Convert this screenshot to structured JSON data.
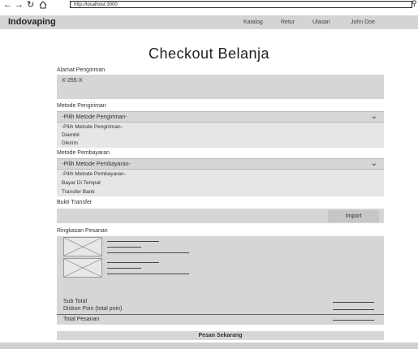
{
  "browser": {
    "back_icon": "arrow-left",
    "forward_icon": "arrow-right",
    "reload_icon": "reload",
    "home_icon": "home",
    "url": "http://localhost:3000",
    "search_icon": "magnifier"
  },
  "header": {
    "brand": "Indovaping",
    "nav": [
      "Katalog",
      "Retur",
      "Ulasan",
      "John Doe"
    ]
  },
  "page": {
    "title": "Checkout Belanja"
  },
  "shipping_address": {
    "label": "Alamat Pengiriman",
    "value": "X-255-X"
  },
  "shipping_method": {
    "label": "Metode Pengiriman",
    "selected": "-Pilih Metode Pengiriman-",
    "options": [
      "-Pilih Metode Pengiriman-",
      "Diambil",
      "Dikirim"
    ]
  },
  "payment_method": {
    "label": "Metode Pembayaran",
    "selected": "-Pilih Metode Pembayaran-",
    "options": [
      "-Pilih Metode Pembayaran-",
      "Bayar Di Tempat",
      "Transfer Bank"
    ]
  },
  "transfer_proof": {
    "label": "Bukti Transfer",
    "import_label": "Import"
  },
  "order_summary": {
    "label": "Ringkasan Pesanan",
    "subtotal_label": "Sub Total",
    "discount_label": "Diskon Poin (total poin)",
    "total_label": "Total Pesanan"
  },
  "submit_label": "Pesan Sekarang"
}
